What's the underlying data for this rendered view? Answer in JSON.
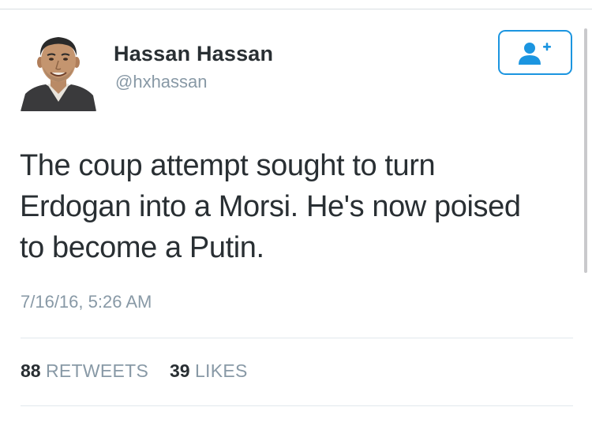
{
  "tweet": {
    "author_name": "Hassan Hassan",
    "author_handle": "@hxhassan",
    "text": "The coup attempt sought to turn\nErdogan into a Morsi. He's now poised\nto become a Putin.",
    "timestamp": "7/16/16, 5:26 AM",
    "stats": {
      "retweets_count": "88",
      "retweets_label": "RETWEETS",
      "likes_count": "39",
      "likes_label": "LIKES"
    }
  },
  "follow_button": {
    "icon": "add-user-icon"
  },
  "colors": {
    "accent": "#1b95e0",
    "text_primary": "#292f33",
    "text_secondary": "#8899a6",
    "divider": "#e1e8ed"
  }
}
